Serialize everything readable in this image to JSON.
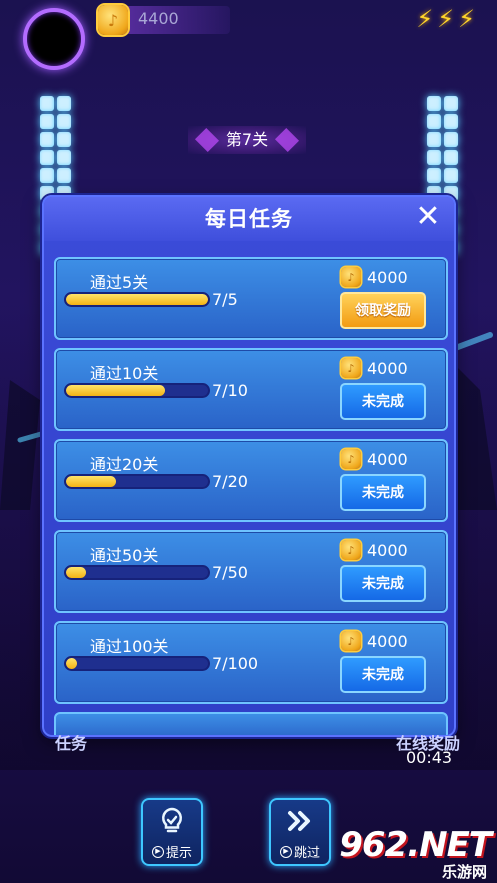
{
  "hud": {
    "coins": "4400",
    "bolt_icons": [
      "bolt-icon",
      "bolt-icon",
      "bolt-icon"
    ]
  },
  "level": {
    "label": "第7关"
  },
  "modal": {
    "title": "每日任务",
    "close_icon": "close-icon",
    "tasks": [
      {
        "title": "通过5关",
        "progress_text": "7/5",
        "progress": 1.0,
        "reward": "4000",
        "button": "领取奖励",
        "state": "claim"
      },
      {
        "title": "通过10关",
        "progress_text": "7/10",
        "progress": 0.7,
        "reward": "4000",
        "button": "未完成",
        "state": "incomplete"
      },
      {
        "title": "通过20关",
        "progress_text": "7/20",
        "progress": 0.35,
        "reward": "4000",
        "button": "未完成",
        "state": "incomplete"
      },
      {
        "title": "通过50关",
        "progress_text": "7/50",
        "progress": 0.14,
        "reward": "4000",
        "button": "未完成",
        "state": "incomplete"
      },
      {
        "title": "通过100关",
        "progress_text": "7/100",
        "progress": 0.07,
        "reward": "4000",
        "button": "未完成",
        "state": "incomplete"
      }
    ]
  },
  "bottom": {
    "left_label": "任务",
    "right_label": "在线奖励",
    "timer": "00:43",
    "hint_label": "提示",
    "skip_label": "跳过"
  },
  "watermark": {
    "main": "962.NET",
    "sub": "乐游网"
  },
  "colors": {
    "accent_gold": "#f4b314",
    "modal_blue": "#3b4cd9",
    "button_blue": "#1569e6",
    "button_orange": "#f29b12"
  }
}
